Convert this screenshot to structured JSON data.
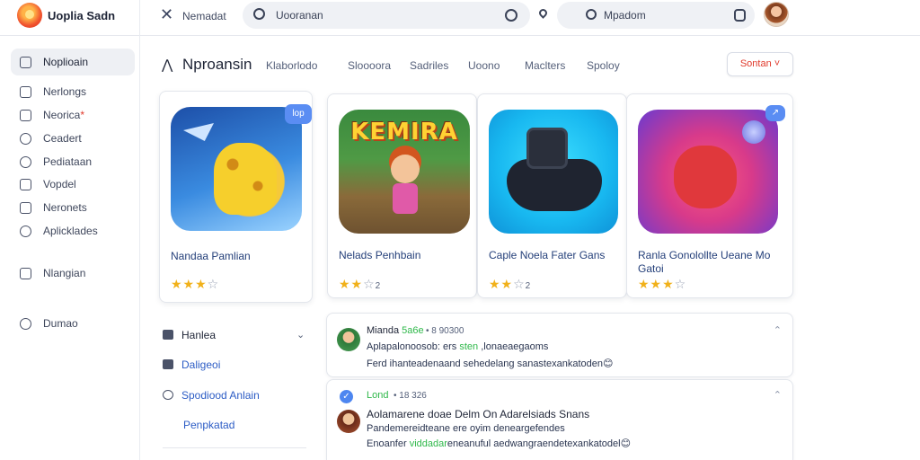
{
  "topbar": {
    "brand": "Uoplia Sadn",
    "tab_title": "Nemadat",
    "search_value": "Uooranan",
    "search2_value": "Mpadom"
  },
  "sidebar": {
    "items": [
      {
        "label": "Noplioain",
        "icon": "document-icon",
        "active": true
      },
      {
        "label": "Nerlongs",
        "icon": "list-icon"
      },
      {
        "label": "Neorica",
        "icon": "mail-icon",
        "badge": "*"
      },
      {
        "label": "Ceadert",
        "icon": "shield-icon"
      },
      {
        "label": "Pediataan",
        "icon": "search-icon"
      },
      {
        "label": "Vopdel",
        "icon": "file-icon"
      },
      {
        "label": "Neronets",
        "icon": "grid-icon"
      },
      {
        "label": "Aplicklades",
        "icon": "globe-icon"
      },
      {
        "label": "Nlangian",
        "icon": "gear-icon"
      },
      {
        "label": "Dumao",
        "icon": "info-icon"
      }
    ]
  },
  "categories": {
    "title": "Nproansin",
    "tabs": [
      "Klaborlodo",
      "Sloooora",
      "Sadriles",
      "Uoono",
      "Maclters",
      "Spoloy"
    ],
    "sort_label": "Sontan ˅"
  },
  "games": [
    {
      "name": "Nandaa Pamlian",
      "stars_on": 3,
      "stars_off": 1,
      "rating_text": "",
      "badge": "lop",
      "thumb_text": ""
    },
    {
      "name": "Nelads Penhbain",
      "stars_on": 2,
      "stars_off": 1,
      "rating_text": "2",
      "badge": "",
      "thumb_text": "KEMIRA"
    },
    {
      "name": "Caple Noela Fater Gans",
      "stars_on": 2,
      "stars_off": 1,
      "rating_text": "2",
      "badge": "",
      "thumb_text": ""
    },
    {
      "name": "Ranla Gonolollte Ueane Mo Gatoi",
      "stars_on": 3,
      "stars_off": 1,
      "rating_text": "",
      "badge": "↗",
      "thumb_text": ""
    }
  ],
  "filter_panel": {
    "heading": "Hanlea",
    "links": [
      "Daligeoi",
      "Spodiood Anlain",
      "Penpkatad"
    ]
  },
  "reviews": [
    {
      "name": "Mianda",
      "name_tag": "5a6e",
      "meta": "• 8 90300",
      "line1_a": "Aplapalonoosob: ers ",
      "line1_b": "sten",
      "line1_c": " ,lonaeaegaoms",
      "line2": "Ferd ihanteadenaand sehedelang sanastexankatoden😊"
    },
    {
      "name": "",
      "name_tag": "Lond",
      "meta": "• 18 326",
      "line1_a": "Aolamarene doae Delm On Adarelsiads Snans",
      "line1_b": "",
      "line1_c": "",
      "line2a": "Pandemereidteane ere oyim deneargefendes",
      "line2b_a": "Enoanfer ",
      "line2b_b": "viddadar",
      "line2b_c": "eneanuful aedwangraendetexankatodel😊"
    }
  ],
  "colors": {
    "accent_blue": "#2c5cc5",
    "accent_red": "#e0392b",
    "star": "#f1b11a",
    "green": "#2fb84a"
  }
}
